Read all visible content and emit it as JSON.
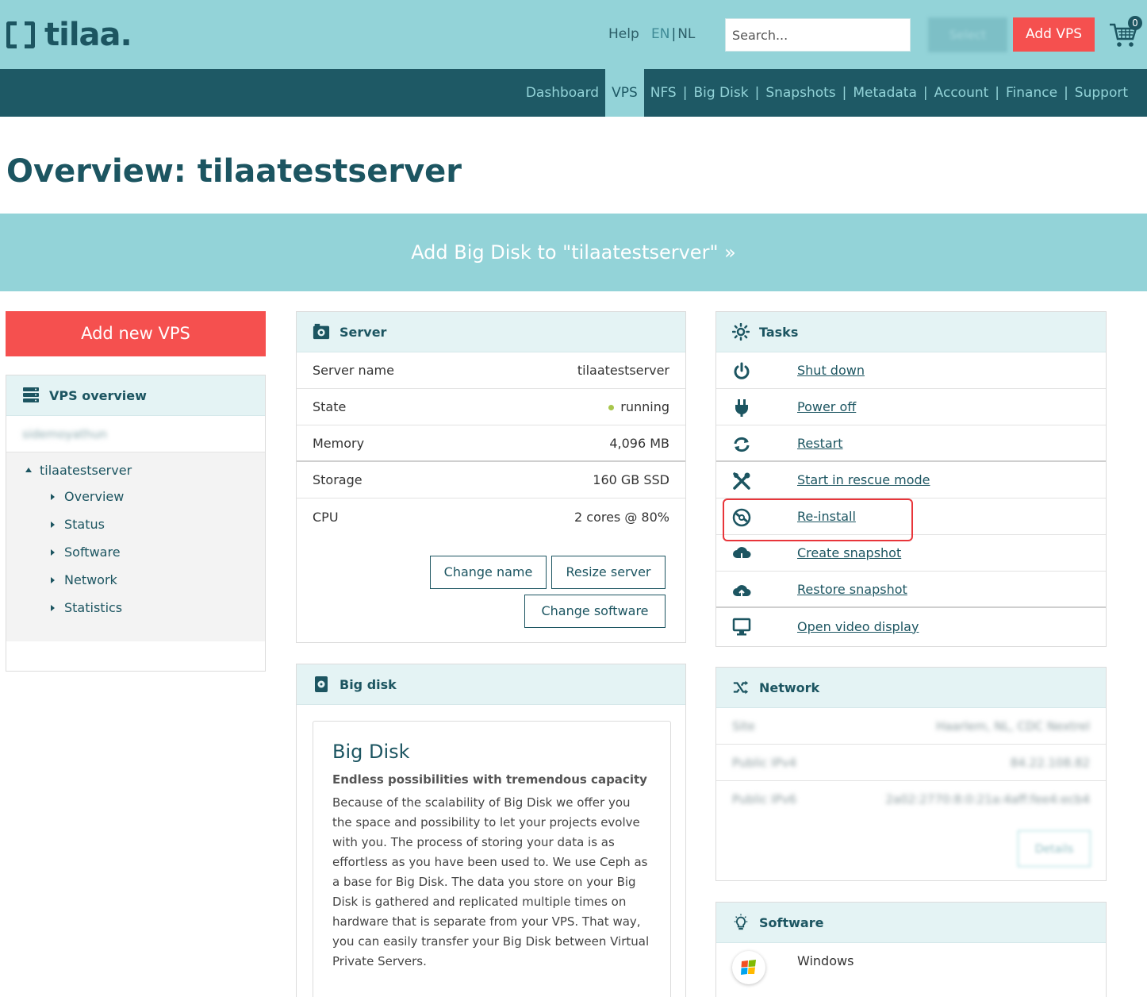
{
  "header": {
    "logo_text": "tilaa.",
    "help": "Help",
    "lang_en": "EN",
    "lang_sep": "|",
    "lang_nl": "NL",
    "search_placeholder": "Search...",
    "blurred_button": "Select",
    "add_vps": "Add VPS",
    "cart_count": "0"
  },
  "nav": {
    "items": [
      "Dashboard",
      "VPS",
      "NFS",
      "Big Disk",
      "Snapshots",
      "Metadata",
      "Account",
      "Finance",
      "Support"
    ],
    "active": "VPS",
    "separator": "|"
  },
  "page": {
    "title": "Overview: tilaatestserver",
    "banner": "Add Big Disk to \"tilaatestserver\" »"
  },
  "sidebar": {
    "add_new": "Add new VPS",
    "header": "VPS overview",
    "blurred_item": "sidemoyathun",
    "root": "tilaatestserver",
    "items": [
      "Overview",
      "Status",
      "Software",
      "Network",
      "Statistics"
    ]
  },
  "server": {
    "header": "Server",
    "rows": [
      {
        "label": "Server name",
        "value": "tilaatestserver"
      },
      {
        "label": "State",
        "value": "running"
      },
      {
        "label": "Memory",
        "value": "4,096 MB"
      },
      {
        "label": "Storage",
        "value": "160 GB SSD"
      },
      {
        "label": "CPU",
        "value": "2 cores @ 80%"
      }
    ],
    "change_name": "Change name",
    "resize_server": "Resize server",
    "change_software": "Change software"
  },
  "bigdisk": {
    "header": "Big disk",
    "title": "Big Disk",
    "subtitle": "Endless possibilities with tremendous capacity",
    "text": "Because of the scalability of Big Disk we offer you the space and possibility to let your projects evolve with you. The process of storing your data is as effortless as you have been used to. We use Ceph as a base for Big Disk. The data you store on your Big Disk is gathered and replicated multiple times on hardware that is separate from your VPS. That way, you can easily transfer your Big Disk between Virtual Private Servers."
  },
  "tasks": {
    "header": "Tasks",
    "items": [
      "Shut down",
      "Power off",
      "Restart",
      "Start in rescue mode",
      "Re-install",
      "Create snapshot",
      "Restore snapshot",
      "Open video display"
    ]
  },
  "network": {
    "header": "Network",
    "rows": [
      {
        "label": "Site",
        "value": "Haarlem, NL, CDC Nextrel"
      },
      {
        "label": "Public IPv4",
        "value": "84.22.108.82"
      },
      {
        "label": "Public IPv6",
        "value": "2a02:2770:8:0:21a:4aff:fee4:ecb4"
      }
    ],
    "details_button": "Details"
  },
  "software": {
    "header": "Software",
    "os": "Windows"
  },
  "colors": {
    "teal_light": "#93d3d8",
    "teal_dark": "#1e5965",
    "accent_red": "#f5504f",
    "running_dot": "#a8c64c",
    "highlight_box": "#e8353a"
  }
}
